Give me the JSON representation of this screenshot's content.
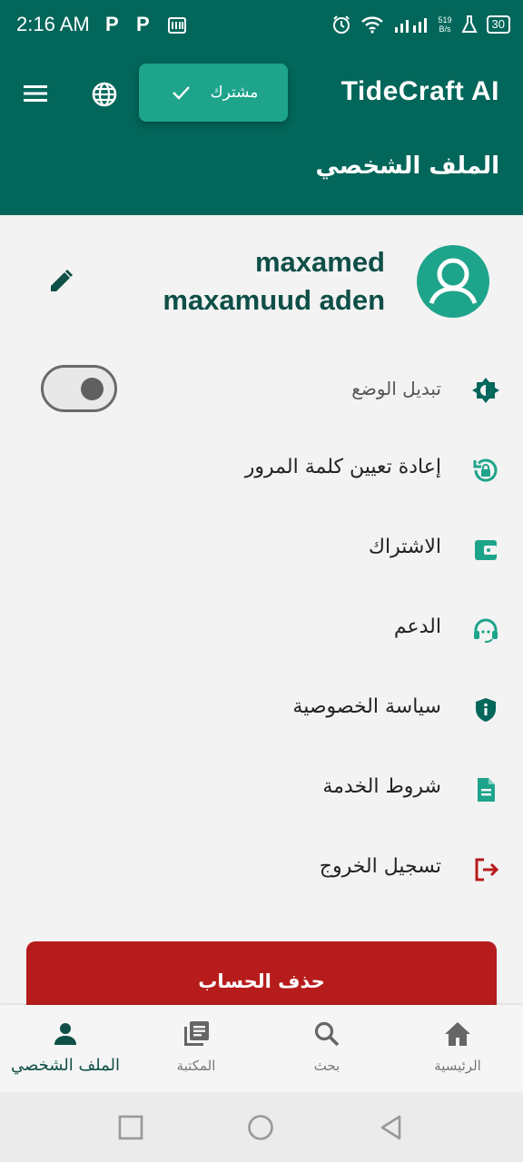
{
  "status_bar": {
    "time": "2:16 AM",
    "notifications": [
      "P",
      "P"
    ],
    "net_speed_value": "519",
    "net_speed_unit": "B/s",
    "battery": "30",
    "icons": [
      "alarm-icon",
      "wifi-icon",
      "signal-icon",
      "lab-icon",
      "battery-icon"
    ]
  },
  "app_bar": {
    "title": "TideCraft AI",
    "page_title": "الملف الشخصي",
    "subscribed_label": "مشترك",
    "icons": [
      "menu-icon",
      "globe-icon",
      "check-icon"
    ]
  },
  "profile": {
    "name_line1": "maxamed",
    "name_line2": "maxamuud aden",
    "icons": [
      "avatar-icon",
      "edit-icon"
    ]
  },
  "menu": {
    "items": [
      {
        "label": "تبديل الوضع",
        "icon": "brightness-icon"
      },
      {
        "label": "إعادة تعيين كلمة المرور",
        "icon": "lock-reset-icon"
      },
      {
        "label": "الاشتراك",
        "icon": "wallet-icon"
      },
      {
        "label": "الدعم",
        "icon": "support-icon"
      },
      {
        "label": "سياسة الخصوصية",
        "icon": "privacy-shield-icon"
      },
      {
        "label": "شروط الخدمة",
        "icon": "document-icon"
      },
      {
        "label": "تسجيل الخروج",
        "icon": "logout-icon"
      }
    ],
    "dark_mode_enabled": false
  },
  "delete_account": {
    "label": "حذف الحساب"
  },
  "bottom_nav": {
    "items": [
      {
        "label": "الملف الشخصي",
        "icon": "person-icon",
        "active": true
      },
      {
        "label": "المكتبة",
        "icon": "library-icon",
        "active": false
      },
      {
        "label": "بحث",
        "icon": "search-icon",
        "active": false
      },
      {
        "label": "الرئيسية",
        "icon": "home-icon",
        "active": false
      }
    ]
  },
  "colors": {
    "primary": "#02665a",
    "accent": "#1ea48b",
    "danger": "#b71c1c",
    "text_dark": "#0e4f47"
  }
}
